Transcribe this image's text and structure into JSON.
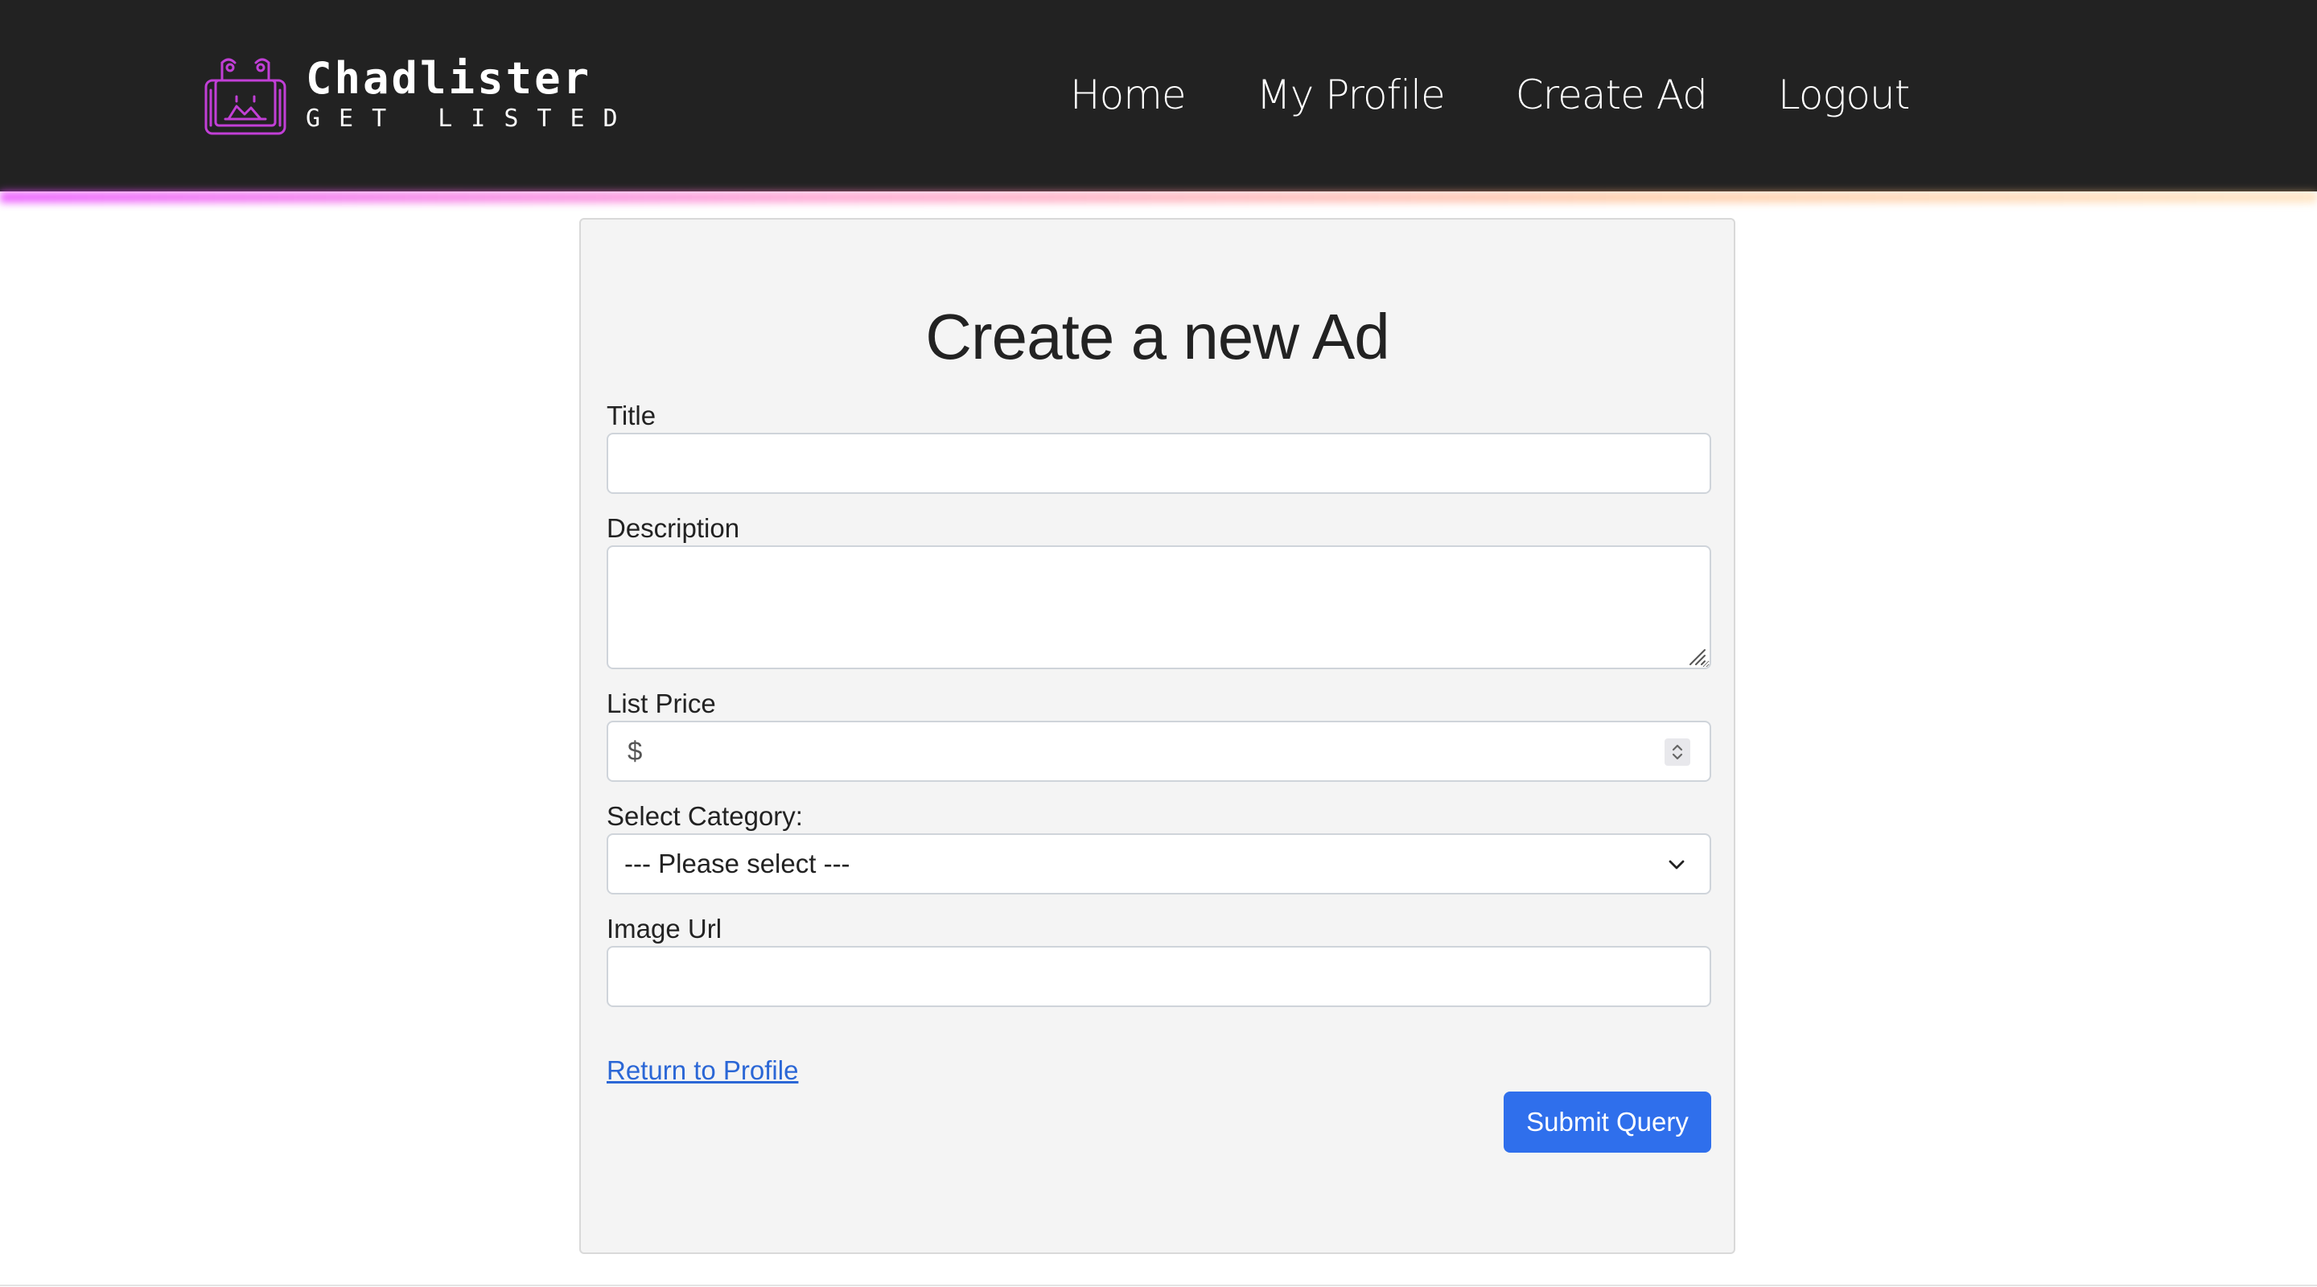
{
  "brand": {
    "name": "Chadlister",
    "tagline": "GET LISTED",
    "logo_icon": "shopping-bag-icon",
    "accent_color": "#c13fd6"
  },
  "nav": {
    "items": [
      {
        "label": "Home"
      },
      {
        "label": "My Profile"
      },
      {
        "label": "Create Ad"
      },
      {
        "label": "Logout"
      }
    ]
  },
  "form": {
    "title": "Create a new Ad",
    "fields": {
      "title": {
        "label": "Title",
        "value": "",
        "placeholder": ""
      },
      "description": {
        "label": "Description",
        "value": "",
        "placeholder": ""
      },
      "price": {
        "label": "List Price",
        "value": "",
        "placeholder": "$"
      },
      "category": {
        "label": "Select Category:",
        "selected": "--- Please select ---"
      },
      "image_url": {
        "label": "Image Url",
        "value": "",
        "placeholder": ""
      }
    },
    "return_link": "Return to Profile",
    "submit_label": "Submit Query"
  },
  "colors": {
    "navbar_bg": "#222222",
    "card_bg": "#f4f4f4",
    "primary_button": "#2f6fec",
    "link": "#2b67d6"
  }
}
